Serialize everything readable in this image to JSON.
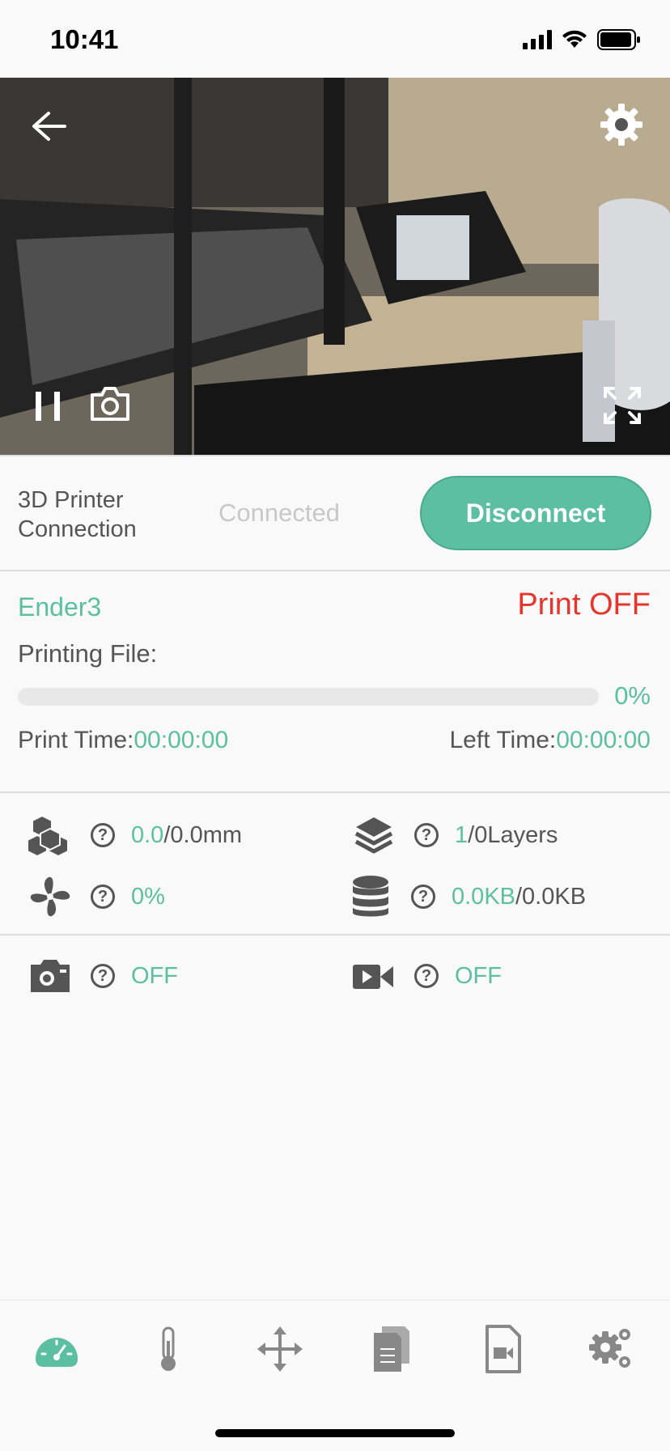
{
  "status_bar": {
    "time": "10:41"
  },
  "connection": {
    "label": "3D Printer Connection",
    "status": "Connected",
    "disconnect_label": "Disconnect"
  },
  "print_info": {
    "printer_name": "Ender3",
    "state": "Print OFF",
    "printing_file_label": "Printing File:",
    "progress_percent": 0,
    "progress_text": "0%",
    "print_time_label": "Print Time:",
    "print_time_value": "00:00:00",
    "left_time_label": "Left Time:",
    "left_time_value": "00:00:00"
  },
  "stats": {
    "height_current": "0.0",
    "height_total": "/0.0mm",
    "layer_current": "1",
    "layer_total": "/0Layers",
    "fan": "0%",
    "data_current": "0.0KB",
    "data_total": "/0.0KB"
  },
  "media": {
    "photo_status": "OFF",
    "video_status": "OFF"
  },
  "colors": {
    "accent": "#5cc0a0",
    "alert": "#e5352c"
  },
  "tabs": [
    "dashboard-icon",
    "thermometer-icon",
    "move-icon",
    "files-icon",
    "video-file-icon",
    "settings-icon"
  ]
}
